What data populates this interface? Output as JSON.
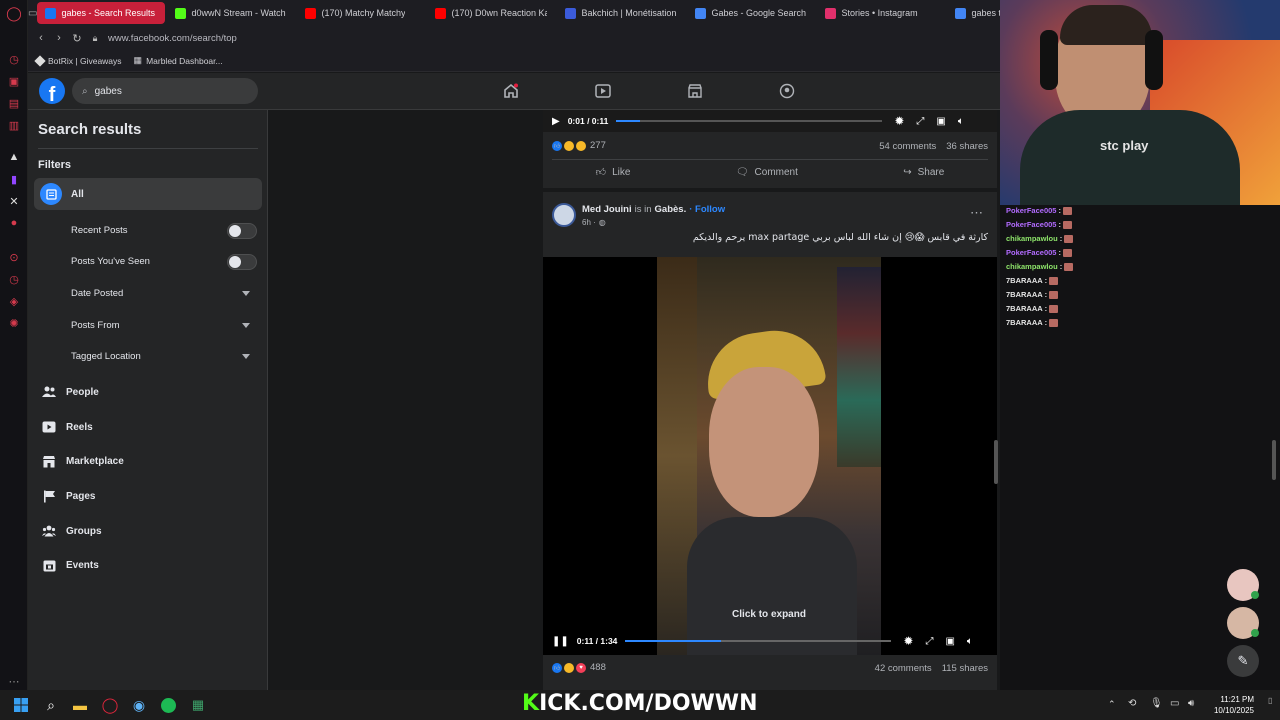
{
  "browser": {
    "tabs": [
      {
        "label": "gabes - Search Results",
        "active": true,
        "favicon": "facebook-icon",
        "color": "#1877f2"
      },
      {
        "label": "d0wwN Stream - Watch l",
        "favicon": "kick-icon",
        "color": "#53fc18"
      },
      {
        "label": "(170) Matchy Matchy",
        "favicon": "youtube-icon",
        "color": "#ff0000"
      },
      {
        "label": "(170) D0wn Reaction Kan",
        "favicon": "youtube-icon",
        "color": "#ff0000"
      },
      {
        "label": "Bakchich | Monétisation",
        "favicon": "bakchich-icon",
        "color": "#3b5bdb"
      },
      {
        "label": "Gabes - Google Search",
        "favicon": "google-icon",
        "color": "#4285f4"
      },
      {
        "label": "Stories • Instagram",
        "favicon": "instagram-icon",
        "color": "#e1306c"
      },
      {
        "label": "gabes t",
        "favicon": "google-icon",
        "color": "#4285f4"
      }
    ],
    "url": "www.facebook.com/search/top",
    "bookmarks": [
      "BotRix | Giveaways",
      "Marbled Dashboar..."
    ]
  },
  "facebook": {
    "search_value": "gabes",
    "left": {
      "title": "Search results",
      "filters_label": "Filters",
      "all_label": "All",
      "filters": [
        {
          "label": "Recent Posts",
          "type": "toggle"
        },
        {
          "label": "Posts You've Seen",
          "type": "toggle"
        },
        {
          "label": "Date Posted",
          "type": "dropdown"
        },
        {
          "label": "Posts From",
          "type": "dropdown"
        },
        {
          "label": "Tagged Location",
          "type": "dropdown"
        }
      ],
      "categories": [
        {
          "label": "People",
          "icon": "people-icon"
        },
        {
          "label": "Reels",
          "icon": "reels-icon"
        },
        {
          "label": "Marketplace",
          "icon": "marketplace-icon"
        },
        {
          "label": "Pages",
          "icon": "pages-icon"
        },
        {
          "label": "Groups",
          "icon": "groups-icon"
        },
        {
          "label": "Events",
          "icon": "events-icon"
        }
      ]
    },
    "post1": {
      "time": "0:01 / 0:11",
      "progress": 0.09,
      "reactions": "277",
      "comments": "54 comments",
      "shares": "36 shares",
      "like": "Like",
      "comment": "Comment",
      "share": "Share"
    },
    "post2": {
      "author": "Med Jouini",
      "is_in": "is in",
      "place": "Gabès.",
      "follow": "· Follow",
      "time_ago": "6h ·",
      "text": "كارثة في قابس 😱😢 إن شاء الله لباس بربي max partage يرحم والديكم",
      "overlay": "Click to expand",
      "time": "0:11 / 1:34",
      "progress": 0.36,
      "reactions": "488",
      "comments": "42 comments",
      "shares": "115 shares"
    }
  },
  "stream": {
    "chat": [
      {
        "user": "PokerFace005",
        "color": "#b26bff"
      },
      {
        "user": "PokerFace005",
        "color": "#b26bff"
      },
      {
        "user": "chikampawlou",
        "color": "#8de36a"
      },
      {
        "user": "PokerFace005",
        "color": "#b26bff"
      },
      {
        "user": "chikampawlou",
        "color": "#8de36a"
      },
      {
        "user": "7BARAAA",
        "color": "#e6e6e6"
      },
      {
        "user": "7BARAAA",
        "color": "#e6e6e6"
      },
      {
        "user": "7BARAAA",
        "color": "#e6e6e6"
      },
      {
        "user": "7BARAAA",
        "color": "#e6e6e6"
      }
    ],
    "jersey": "stc play",
    "banner_prefix": "K",
    "banner_rest": "ICK.COM/DOWWN"
  },
  "taskbar": {
    "time": "11:21 PM",
    "date": "10/10/2025"
  }
}
